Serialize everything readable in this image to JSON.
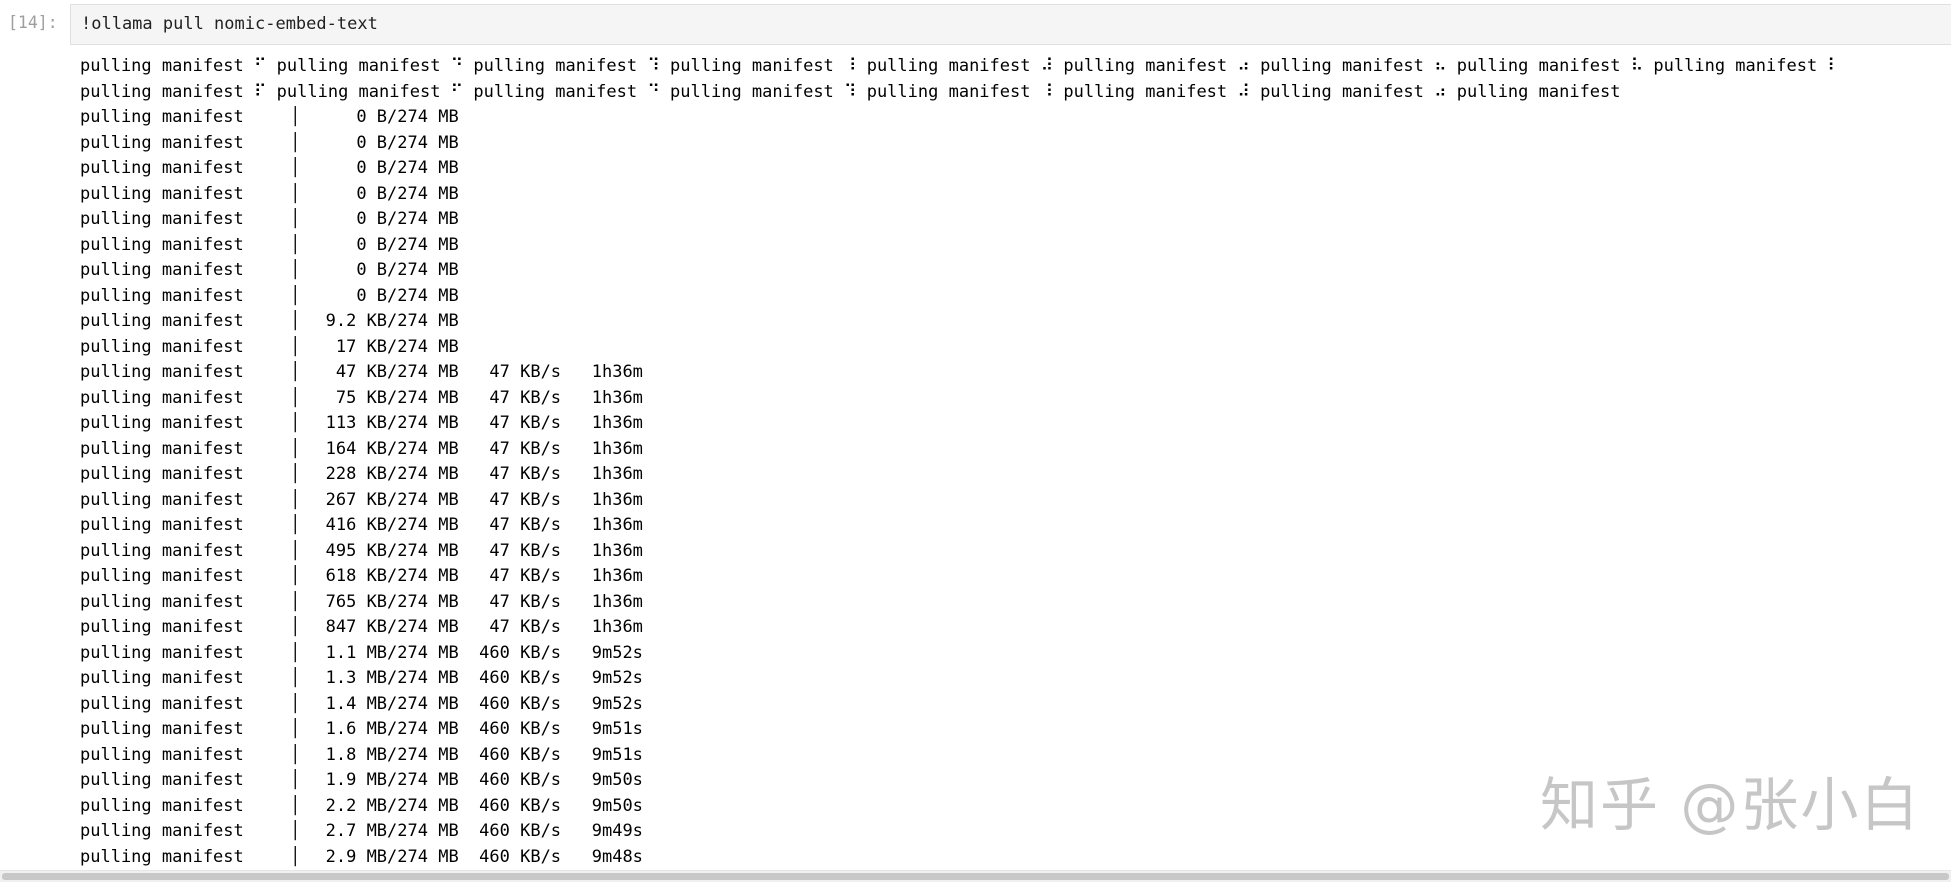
{
  "cell": {
    "prompt": "[14]:",
    "input": "!ollama pull nomic-embed-text"
  },
  "output": {
    "lines": [
      "pulling manifest ⠋ pulling manifest ⠙ pulling manifest ⠹ pulling manifest ⠸ pulling manifest ⠼ pulling manifest ⠴ pulling manifest ⠦ pulling manifest ⠧ pulling manifest ⠇",
      "pulling manifest ⠏ pulling manifest ⠋ pulling manifest ⠙ pulling manifest ⠹ pulling manifest ⠸ pulling manifest ⠼ pulling manifest ⠴ pulling manifest",
      "pulling manifest     ▏     0 B/274 MB",
      "pulling manifest     ▏     0 B/274 MB",
      "pulling manifest     ▏     0 B/274 MB",
      "pulling manifest     ▏     0 B/274 MB",
      "pulling manifest     ▏     0 B/274 MB",
      "pulling manifest     ▏     0 B/274 MB",
      "pulling manifest     ▏     0 B/274 MB",
      "pulling manifest     ▏     0 B/274 MB",
      "pulling manifest     ▏  9.2 KB/274 MB",
      "pulling manifest     ▏   17 KB/274 MB",
      "pulling manifest     ▏   47 KB/274 MB   47 KB/s   1h36m",
      "pulling manifest     ▏   75 KB/274 MB   47 KB/s   1h36m",
      "pulling manifest     ▏  113 KB/274 MB   47 KB/s   1h36m",
      "pulling manifest     ▏  164 KB/274 MB   47 KB/s   1h36m",
      "pulling manifest     ▏  228 KB/274 MB   47 KB/s   1h36m",
      "pulling manifest     ▏  267 KB/274 MB   47 KB/s   1h36m",
      "pulling manifest     ▏  416 KB/274 MB   47 KB/s   1h36m",
      "pulling manifest     ▏  495 KB/274 MB   47 KB/s   1h36m",
      "pulling manifest     ▏  618 KB/274 MB   47 KB/s   1h36m",
      "pulling manifest     ▏  765 KB/274 MB   47 KB/s   1h36m",
      "pulling manifest     ▏  847 KB/274 MB   47 KB/s   1h36m",
      "pulling manifest     ▏  1.1 MB/274 MB  460 KB/s   9m52s",
      "pulling manifest     ▏  1.3 MB/274 MB  460 KB/s   9m52s",
      "pulling manifest     ▏  1.4 MB/274 MB  460 KB/s   9m52s",
      "pulling manifest     ▏  1.6 MB/274 MB  460 KB/s   9m51s",
      "pulling manifest     ▏  1.8 MB/274 MB  460 KB/s   9m51s",
      "pulling manifest     ▏  1.9 MB/274 MB  460 KB/s   9m50s",
      "pulling manifest     ▏  2.2 MB/274 MB  460 KB/s   9m50s",
      "pulling manifest     ▏  2.7 MB/274 MB  460 KB/s   9m49s",
      "pulling manifest     ▏  2.9 MB/274 MB  460 KB/s   9m48s"
    ]
  },
  "watermark": "知乎 @张小白",
  "colors": {
    "input_bg": "#f5f5f5",
    "prompt": "#9e9e9e",
    "text": "#000000"
  }
}
